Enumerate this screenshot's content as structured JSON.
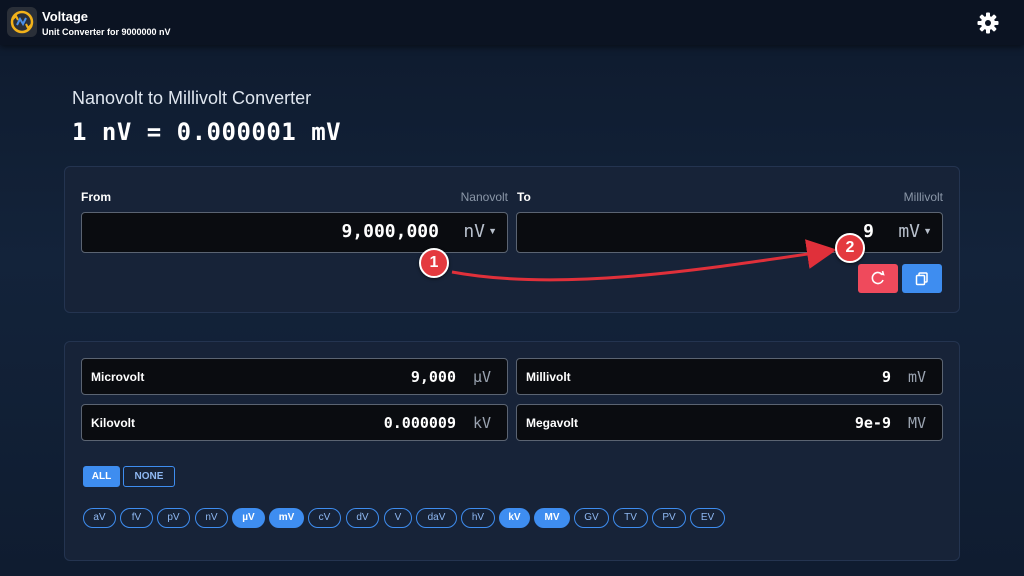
{
  "header": {
    "app_title": "Voltage",
    "app_subtitle": "Unit Converter for 9000000 nV",
    "settings_icon": "gear-icon",
    "app_icon": "voltage-converter-logo"
  },
  "main": {
    "heading": "Nanovolt to Millivolt Converter",
    "formula": "1 nV = 0.000001 mV"
  },
  "converter": {
    "from_label": "From",
    "from_unit_name": "Nanovolt",
    "from_value": "9,000,000",
    "from_unit": "nV",
    "to_label": "To",
    "to_unit_name": "Millivolt",
    "to_value": "9",
    "to_unit": "mV",
    "reset_icon": "refresh-icon",
    "copy_icon": "copy-icon"
  },
  "results": [
    {
      "name": "Microvolt",
      "value": "9,000",
      "unit": "µV"
    },
    {
      "name": "Millivolt",
      "value": "9",
      "unit": "mV"
    },
    {
      "name": "Kilovolt",
      "value": "0.000009",
      "unit": "kV"
    },
    {
      "name": "Megavolt",
      "value": "9e-9",
      "unit": "MV"
    }
  ],
  "filter": {
    "all_label": "ALL",
    "none_label": "NONE",
    "chips": [
      {
        "label": "aV",
        "active": false
      },
      {
        "label": "fV",
        "active": false
      },
      {
        "label": "pV",
        "active": false
      },
      {
        "label": "nV",
        "active": false
      },
      {
        "label": "µV",
        "active": true
      },
      {
        "label": "mV",
        "active": true
      },
      {
        "label": "cV",
        "active": false
      },
      {
        "label": "dV",
        "active": false
      },
      {
        "label": "V",
        "active": false
      },
      {
        "label": "daV",
        "active": false
      },
      {
        "label": "hV",
        "active": false
      },
      {
        "label": "kV",
        "active": true
      },
      {
        "label": "MV",
        "active": true
      },
      {
        "label": "GV",
        "active": false
      },
      {
        "label": "TV",
        "active": false
      },
      {
        "label": "PV",
        "active": false
      },
      {
        "label": "EV",
        "active": false
      }
    ]
  },
  "annotations": {
    "badge_1": "1",
    "badge_2": "2",
    "arrow_color": "#e0303a"
  },
  "colors": {
    "accent": "#3e8df0",
    "danger": "#ef4a5c",
    "background": "#13233a"
  }
}
